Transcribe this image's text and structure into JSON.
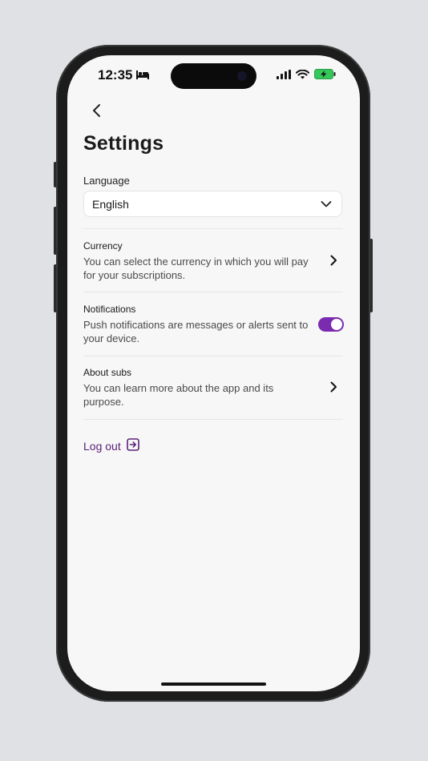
{
  "status_bar": {
    "time": "12:35",
    "icons": [
      "bed-icon",
      "cellular-signal-icon",
      "wifi-icon",
      "battery-charging-icon"
    ]
  },
  "header": {
    "back_icon": "chevron-left-icon",
    "title": "Settings"
  },
  "language": {
    "label": "Language",
    "selected": "English",
    "icon": "chevron-down-icon"
  },
  "settings_rows": [
    {
      "title": "Currency",
      "description": "You can select the currency in which you will pay for your subscriptions.",
      "control": "chevron-right-icon"
    },
    {
      "title": "Notifications",
      "description": "Push notifications are messages or alerts sent to your device.",
      "control": "toggle",
      "toggle_on": true
    },
    {
      "title": "About subs",
      "description": "You can learn more about the app and its purpose.",
      "control": "chevron-right-icon"
    }
  ],
  "logout": {
    "label": "Log out",
    "icon": "logout-arrow-icon"
  },
  "colors": {
    "accent": "#7b2bb0",
    "logout_text": "#5a2179",
    "battery": "#34c759",
    "background": "#f7f7f7"
  }
}
